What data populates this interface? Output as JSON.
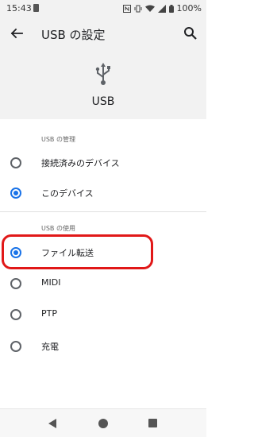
{
  "status_bar": {
    "time": "15:43",
    "battery": "100%"
  },
  "app_bar": {
    "title": "USB の設定",
    "back_icon": "arrow-back-icon",
    "search_icon": "search-icon"
  },
  "hero": {
    "icon": "usb-icon",
    "label": "USB"
  },
  "sections": [
    {
      "title": "USB の管理",
      "options": [
        {
          "label": "接続済みのデバイス",
          "selected": false
        },
        {
          "label": "このデバイス",
          "selected": true
        }
      ]
    },
    {
      "title": "USB の使用",
      "options": [
        {
          "label": "ファイル転送",
          "selected": true
        },
        {
          "label": "MIDI",
          "selected": false
        },
        {
          "label": "PTP",
          "selected": false
        },
        {
          "label": "充電",
          "selected": false
        }
      ]
    }
  ],
  "colors": {
    "accent": "#1a73e8",
    "highlight": "#e11818"
  }
}
